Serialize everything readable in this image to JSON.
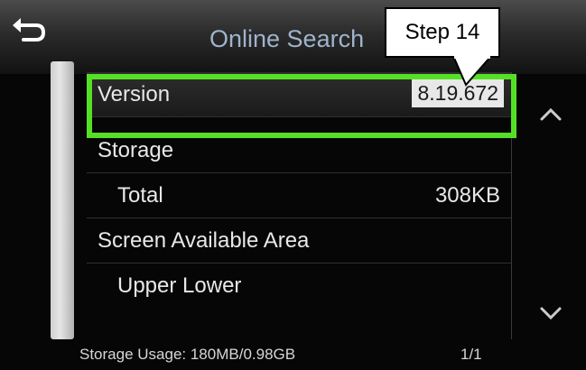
{
  "screen": {
    "title": "Online Search",
    "back_icon": "back-arrow-icon"
  },
  "callout": {
    "text": "Step 14"
  },
  "list": {
    "rows": [
      {
        "label": "Version",
        "value": "8.19.672"
      },
      {
        "label": "Storage",
        "value": ""
      },
      {
        "label": "Total",
        "value": "308KB"
      },
      {
        "label": "Screen Available Area",
        "value": ""
      },
      {
        "label": "Upper Lower",
        "value": ""
      }
    ]
  },
  "status": {
    "storage_usage": "Storage Usage: 180MB/0.98GB",
    "page_indicator": "1/1"
  },
  "colors": {
    "highlight": "#55e026",
    "title_text": "#9fb3cc",
    "background": "#060606"
  },
  "icons": {
    "scroll_up": "chevron-up-icon",
    "scroll_down": "chevron-down-icon"
  }
}
